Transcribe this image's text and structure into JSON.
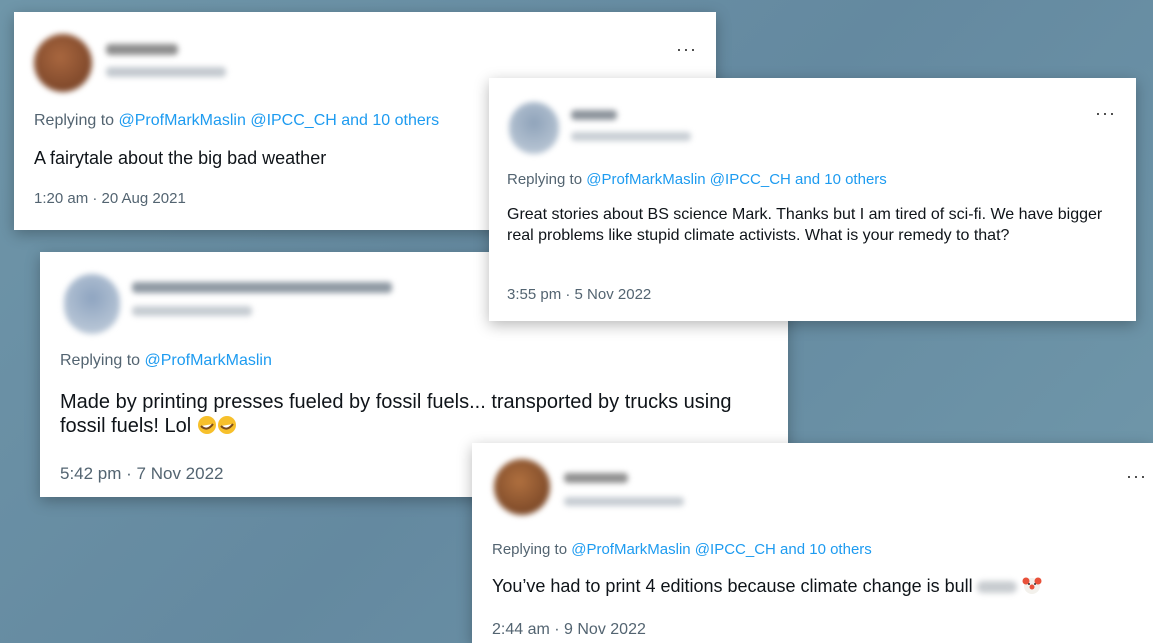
{
  "background_color": "#6d93a6",
  "accent_color": "#1d9bf0",
  "more_icon": "more-horizontal-icon",
  "tweets": [
    {
      "replying_prefix": "Replying to",
      "handles": "@ProfMarkMaslin @IPCC_CH  and 10 others",
      "text": "A fairytale about the big bad weather",
      "timestamp": "1:20 am · 20 Aug 2021"
    },
    {
      "replying_prefix": "Replying to",
      "handles": "@ProfMarkMaslin @IPCC_CH  and 10 others",
      "text": "Great stories about BS science Mark. Thanks but I am tired of sci-fi. We have bigger real problems like stupid climate activists. What is your remedy to that?",
      "timestamp": "3:55 pm · 5 Nov 2022"
    },
    {
      "replying_prefix": "Replying to",
      "handles": "@ProfMarkMaslin",
      "text": "Made by printing presses fueled by fossil fuels... transported by trucks using fossil fuels! Lol",
      "timestamp": "5:42 pm · 7 Nov 2022"
    },
    {
      "replying_prefix": "Replying to",
      "handles": "@ProfMarkMaslin @IPCC_CH  and 10 others",
      "text": "You’ve had to print 4 editions because climate change is bull",
      "timestamp": "2:44 am · 9 Nov 2022"
    }
  ]
}
